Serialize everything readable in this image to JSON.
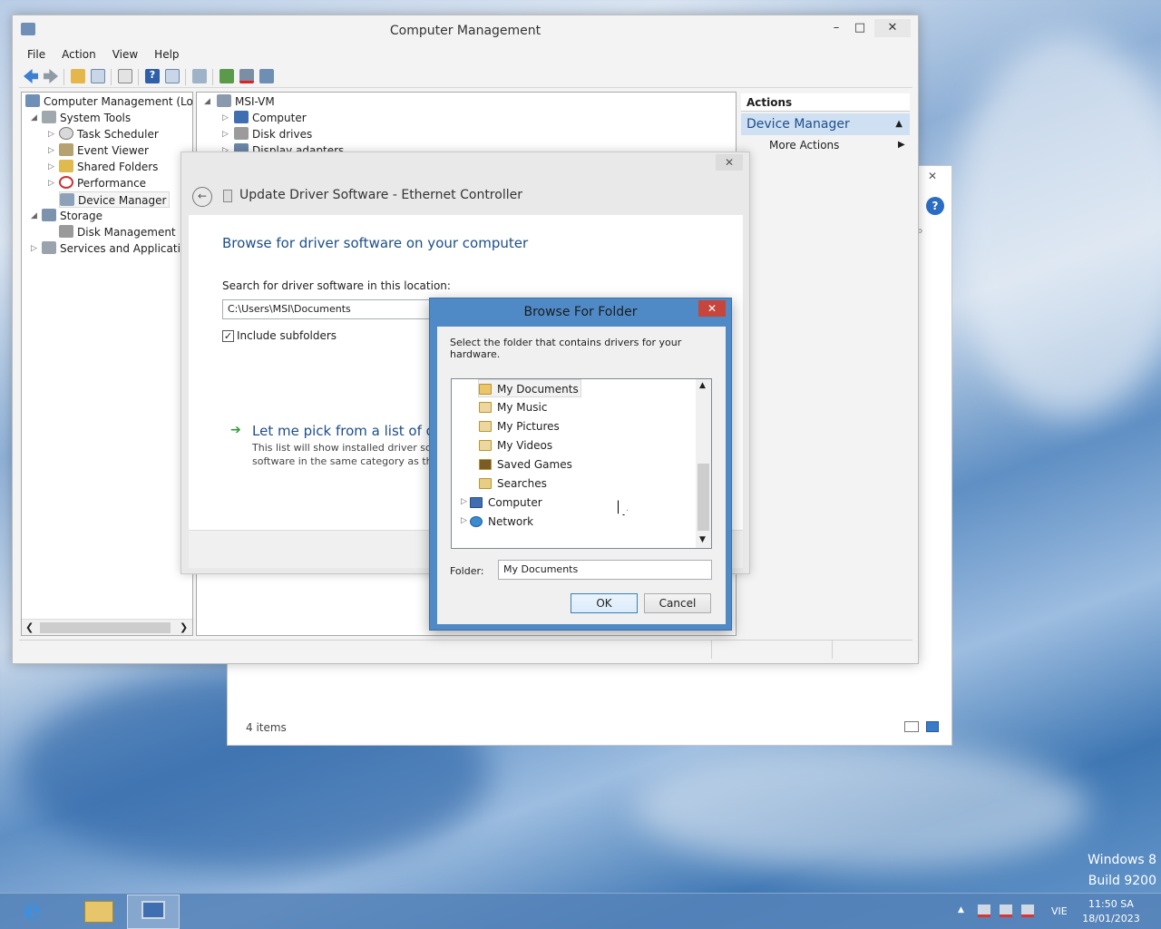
{
  "computer_management": {
    "title": "Computer Management",
    "menu": [
      "File",
      "Action",
      "View",
      "Help"
    ],
    "tree": [
      {
        "label": "Computer Management (Local",
        "indent": 0,
        "icon": "computer-management-icon"
      },
      {
        "label": "System Tools",
        "indent": 1,
        "icon": "system-tools-icon"
      },
      {
        "label": "Task Scheduler",
        "indent": 2,
        "icon": "task-scheduler-icon"
      },
      {
        "label": "Event Viewer",
        "indent": 2,
        "icon": "event-viewer-icon"
      },
      {
        "label": "Shared Folders",
        "indent": 2,
        "icon": "shared-folders-icon"
      },
      {
        "label": "Performance",
        "indent": 2,
        "icon": "performance-icon"
      },
      {
        "label": "Device Manager",
        "indent": 2,
        "icon": "device-manager-icon"
      },
      {
        "label": "Storage",
        "indent": 1,
        "icon": "storage-icon"
      },
      {
        "label": "Disk Management",
        "indent": 2,
        "icon": "disk-management-icon"
      },
      {
        "label": "Services and Applications",
        "indent": 1,
        "icon": "services-icon"
      }
    ],
    "devices": {
      "root": "MSI-VM",
      "items": [
        "Computer",
        "Disk drives",
        "Display adapters"
      ]
    },
    "actions": {
      "header": "Actions",
      "section": "Device Manager",
      "more": "More Actions"
    }
  },
  "back_window": {
    "status": "4 items"
  },
  "update_driver": {
    "title": "Update Driver Software - Ethernet Controller",
    "heading": "Browse for driver software on your computer",
    "search_label": "Search for driver software in this location:",
    "path_value": "C:\\Users\\MSI\\Documents",
    "include_subfolders": "Include subfolders",
    "pick_title": "Let me pick from a list of dev",
    "pick_desc_1": "This list will show installed driver soft",
    "pick_desc_2": "software in the same category as the"
  },
  "browse_folder": {
    "title": "Browse For Folder",
    "instruction": "Select the folder that contains drivers for your hardware.",
    "items": [
      {
        "label": "My Documents",
        "level": 2,
        "selected": true
      },
      {
        "label": "My Music",
        "level": 2
      },
      {
        "label": "My Pictures",
        "level": 2
      },
      {
        "label": "My Videos",
        "level": 2
      },
      {
        "label": "Saved Games",
        "level": 2
      },
      {
        "label": "Searches",
        "level": 2
      },
      {
        "label": "Computer",
        "level": 1
      },
      {
        "label": "Network",
        "level": 1
      }
    ],
    "folder_label": "Folder:",
    "folder_value": "My Documents",
    "ok": "OK",
    "cancel": "Cancel"
  },
  "desktop": {
    "watermark_1": "Windows 8",
    "watermark_2": "Build 9200"
  },
  "taskbar": {
    "language": "VIE",
    "time": "11:50 SA",
    "date": "18/01/2023"
  },
  "colors": {
    "accent": "#4f8ac7",
    "heading_blue": "#1d4e89",
    "taskbar": "#5582b9"
  }
}
